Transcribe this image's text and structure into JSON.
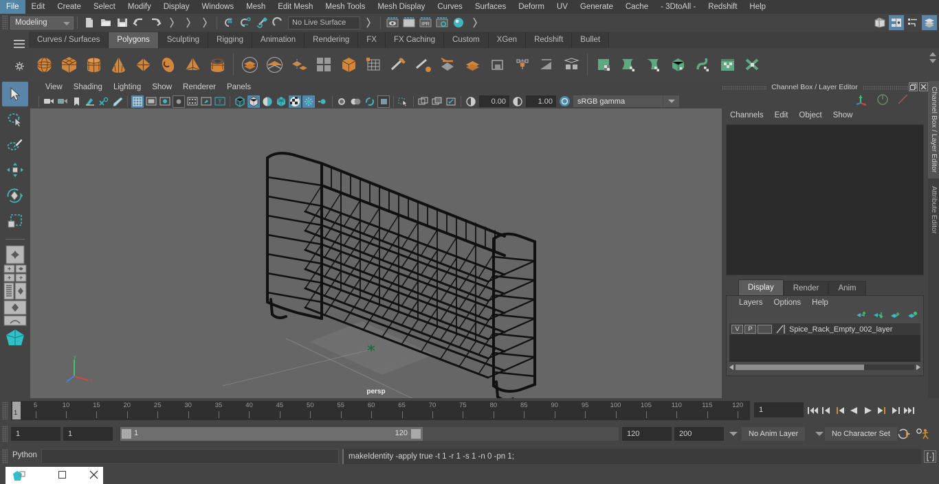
{
  "app": {
    "title": "Autodesk Maya"
  },
  "menubar": {
    "items": [
      "File",
      "Edit",
      "Create",
      "Select",
      "Modify",
      "Display",
      "Windows",
      "Mesh",
      "Edit Mesh",
      "Mesh Tools",
      "Mesh Display",
      "Curves",
      "Surfaces",
      "Deform",
      "UV",
      "Generate",
      "Cache",
      "- 3DtoAll -",
      "Redshift",
      "Help"
    ]
  },
  "statusline": {
    "mode": "Modeling",
    "live_surface": "No Live Surface",
    "icons": [
      "new-scene-icon",
      "open-scene-icon",
      "save-scene-icon",
      "undo-icon",
      "redo-icon",
      "select-by-hierarchy-icon",
      "select-by-object-icon",
      "select-by-component-icon",
      "snap-to-grid-icon",
      "snap-to-curve-icon",
      "snap-to-point-icon",
      "snap-to-projected-center-icon",
      "make-live-icon",
      "render-view-icon",
      "render-current-frame-icon",
      "ipr-render-icon",
      "render-settings-icon",
      "hypershade-icon"
    ],
    "right_icons": [
      "toggle-model-panel-icon",
      "toggle-attribute-editor-icon",
      "toggle-tool-settings-icon",
      "toggle-channel-box-icon"
    ]
  },
  "shelf": {
    "tabs": [
      "Curves / Surfaces",
      "Polygons",
      "Sculpting",
      "Rigging",
      "Animation",
      "Rendering",
      "FX",
      "FX Caching",
      "Custom",
      "XGen",
      "Redshift",
      "Bullet"
    ],
    "active_tab": "Polygons",
    "icons": [
      "poly-sphere-icon",
      "poly-cube-icon",
      "poly-cylinder-icon",
      "poly-cone-icon",
      "poly-plane-icon",
      "poly-torus-icon",
      "poly-pyramid-icon",
      "poly-pipe-icon",
      "combine-icon",
      "separate-icon",
      "extract-icon",
      "booleans-icon",
      "smooth-icon",
      "add-divisions-icon",
      "multi-cut-icon",
      "target-weld-icon",
      "connect-icon",
      "bevel-icon",
      "bridge-icon",
      "append-polygon-icon",
      "wedge-icon",
      "duplicate-face-icon",
      "extrude-icon",
      "poly-quad-draw-icon",
      "sculpt-tool-icon",
      "grab-tool-icon",
      "smooth-tool-icon",
      "relax-tool-icon",
      "pinch-tool-icon",
      "flatten-tool-icon",
      "foamy-tool-icon"
    ]
  },
  "toolbox": {
    "items": [
      "select-tool",
      "lasso-select-tool",
      "paint-select-tool",
      "move-tool",
      "rotate-tool",
      "scale-tool",
      "last-tool-used",
      "single-perspective-view-layout",
      "four-view-layout",
      "persp-outliner-layout",
      "persp-graph-editor-layout",
      "hypershade-persp-layout"
    ],
    "active": "select-tool"
  },
  "viewport": {
    "menus": [
      "View",
      "Shading",
      "Lighting",
      "Show",
      "Renderer",
      "Panels"
    ],
    "camera_label": "persp",
    "exposure": "0.00",
    "gamma": "1.00",
    "color_space": "sRGB gamma",
    "toolbar_icons": [
      "select-camera-icon",
      "camera-attributes-icon",
      "bookmark-icon",
      "image-plane-icon",
      "2d-pan-zoom-icon",
      "grease-pencil-icon",
      "grid-icon",
      "film-gate-icon",
      "resolution-gate-icon",
      "gate-mask-icon",
      "film-origin-icon",
      "xray-icon",
      "xray-joints-icon",
      "exposure-icon",
      "use-default-lighting-icon",
      "shadows-icon",
      "screen-space-ao-icon",
      "motion-blur-icon",
      "multisample-aa-icon",
      "wireframe-on-shaded-icon",
      "texture-icon",
      "isolate-select-icon",
      "display-layer-icon",
      "shaded-icon",
      "smooth-shade-all-icon",
      "flat-shade-icon",
      "bounding-box-icon"
    ]
  },
  "right_panel": {
    "title": "Channel Box / Layer Editor",
    "menus": [
      "Channels",
      "Edit",
      "Object",
      "Show"
    ],
    "dock_buttons": [
      "undock-icon",
      "close-icon"
    ],
    "gizmo_icons": [
      "move-axis-icon",
      "rotate-manip-icon",
      "scale-manip-icon"
    ],
    "vertical_tabs": [
      "Channel Box / Layer Editor",
      "Attribute Editor"
    ]
  },
  "layer_editor": {
    "tabs": [
      "Display",
      "Render",
      "Anim"
    ],
    "active_tab": "Display",
    "menus": [
      "Layers",
      "Options",
      "Help"
    ],
    "tool_icons": [
      "move-layer-up-icon",
      "move-layer-down-icon",
      "new-layer-icon",
      "new-layer-from-selected-icon"
    ],
    "layers": [
      {
        "visibility": "V",
        "playback": "P",
        "shading": "",
        "name": "Spice_Rack_Empty_002_layer"
      }
    ]
  },
  "timeline": {
    "current_frame": "1",
    "start_label": "1",
    "ticks": [
      5,
      10,
      15,
      20,
      25,
      30,
      35,
      40,
      45,
      50,
      55,
      60,
      65,
      70,
      75,
      80,
      85,
      90,
      95,
      100,
      105,
      110,
      115,
      120
    ],
    "frame_field": "1",
    "playback_buttons": [
      "go-to-start-icon",
      "step-back-frame-icon",
      "step-back-key-icon",
      "play-backwards-icon",
      "play-forwards-icon",
      "step-forward-key-icon",
      "step-forward-frame-icon",
      "go-to-end-icon"
    ]
  },
  "range_slider": {
    "anim_start": "1",
    "range_start": "1",
    "bar_start": "1",
    "bar_end": "120",
    "range_end": "120",
    "anim_end": "200",
    "anim_layer": "No Anim Layer",
    "character_set": "No Character Set",
    "right_icons": [
      "auto-key-icon",
      "animation-preferences-icon"
    ]
  },
  "command_line": {
    "language": "Python",
    "input_value": "",
    "output": "makeIdentity -apply true -t 1 -r 1 -s 1 -n 0 -pn 1;",
    "script_editor_icon": "script-editor-icon"
  },
  "taskbar": {
    "window_title": "",
    "buttons": [
      "app-icon",
      "restore-icon",
      "close-icon"
    ]
  },
  "colors": {
    "accent_blue": "#5b85a8",
    "shelf_orange": "#d2873f",
    "shelf_green": "#5fa882",
    "teal": "#3fb6c0",
    "panel_bg": "#444444",
    "viewport_bg": "#666666"
  }
}
